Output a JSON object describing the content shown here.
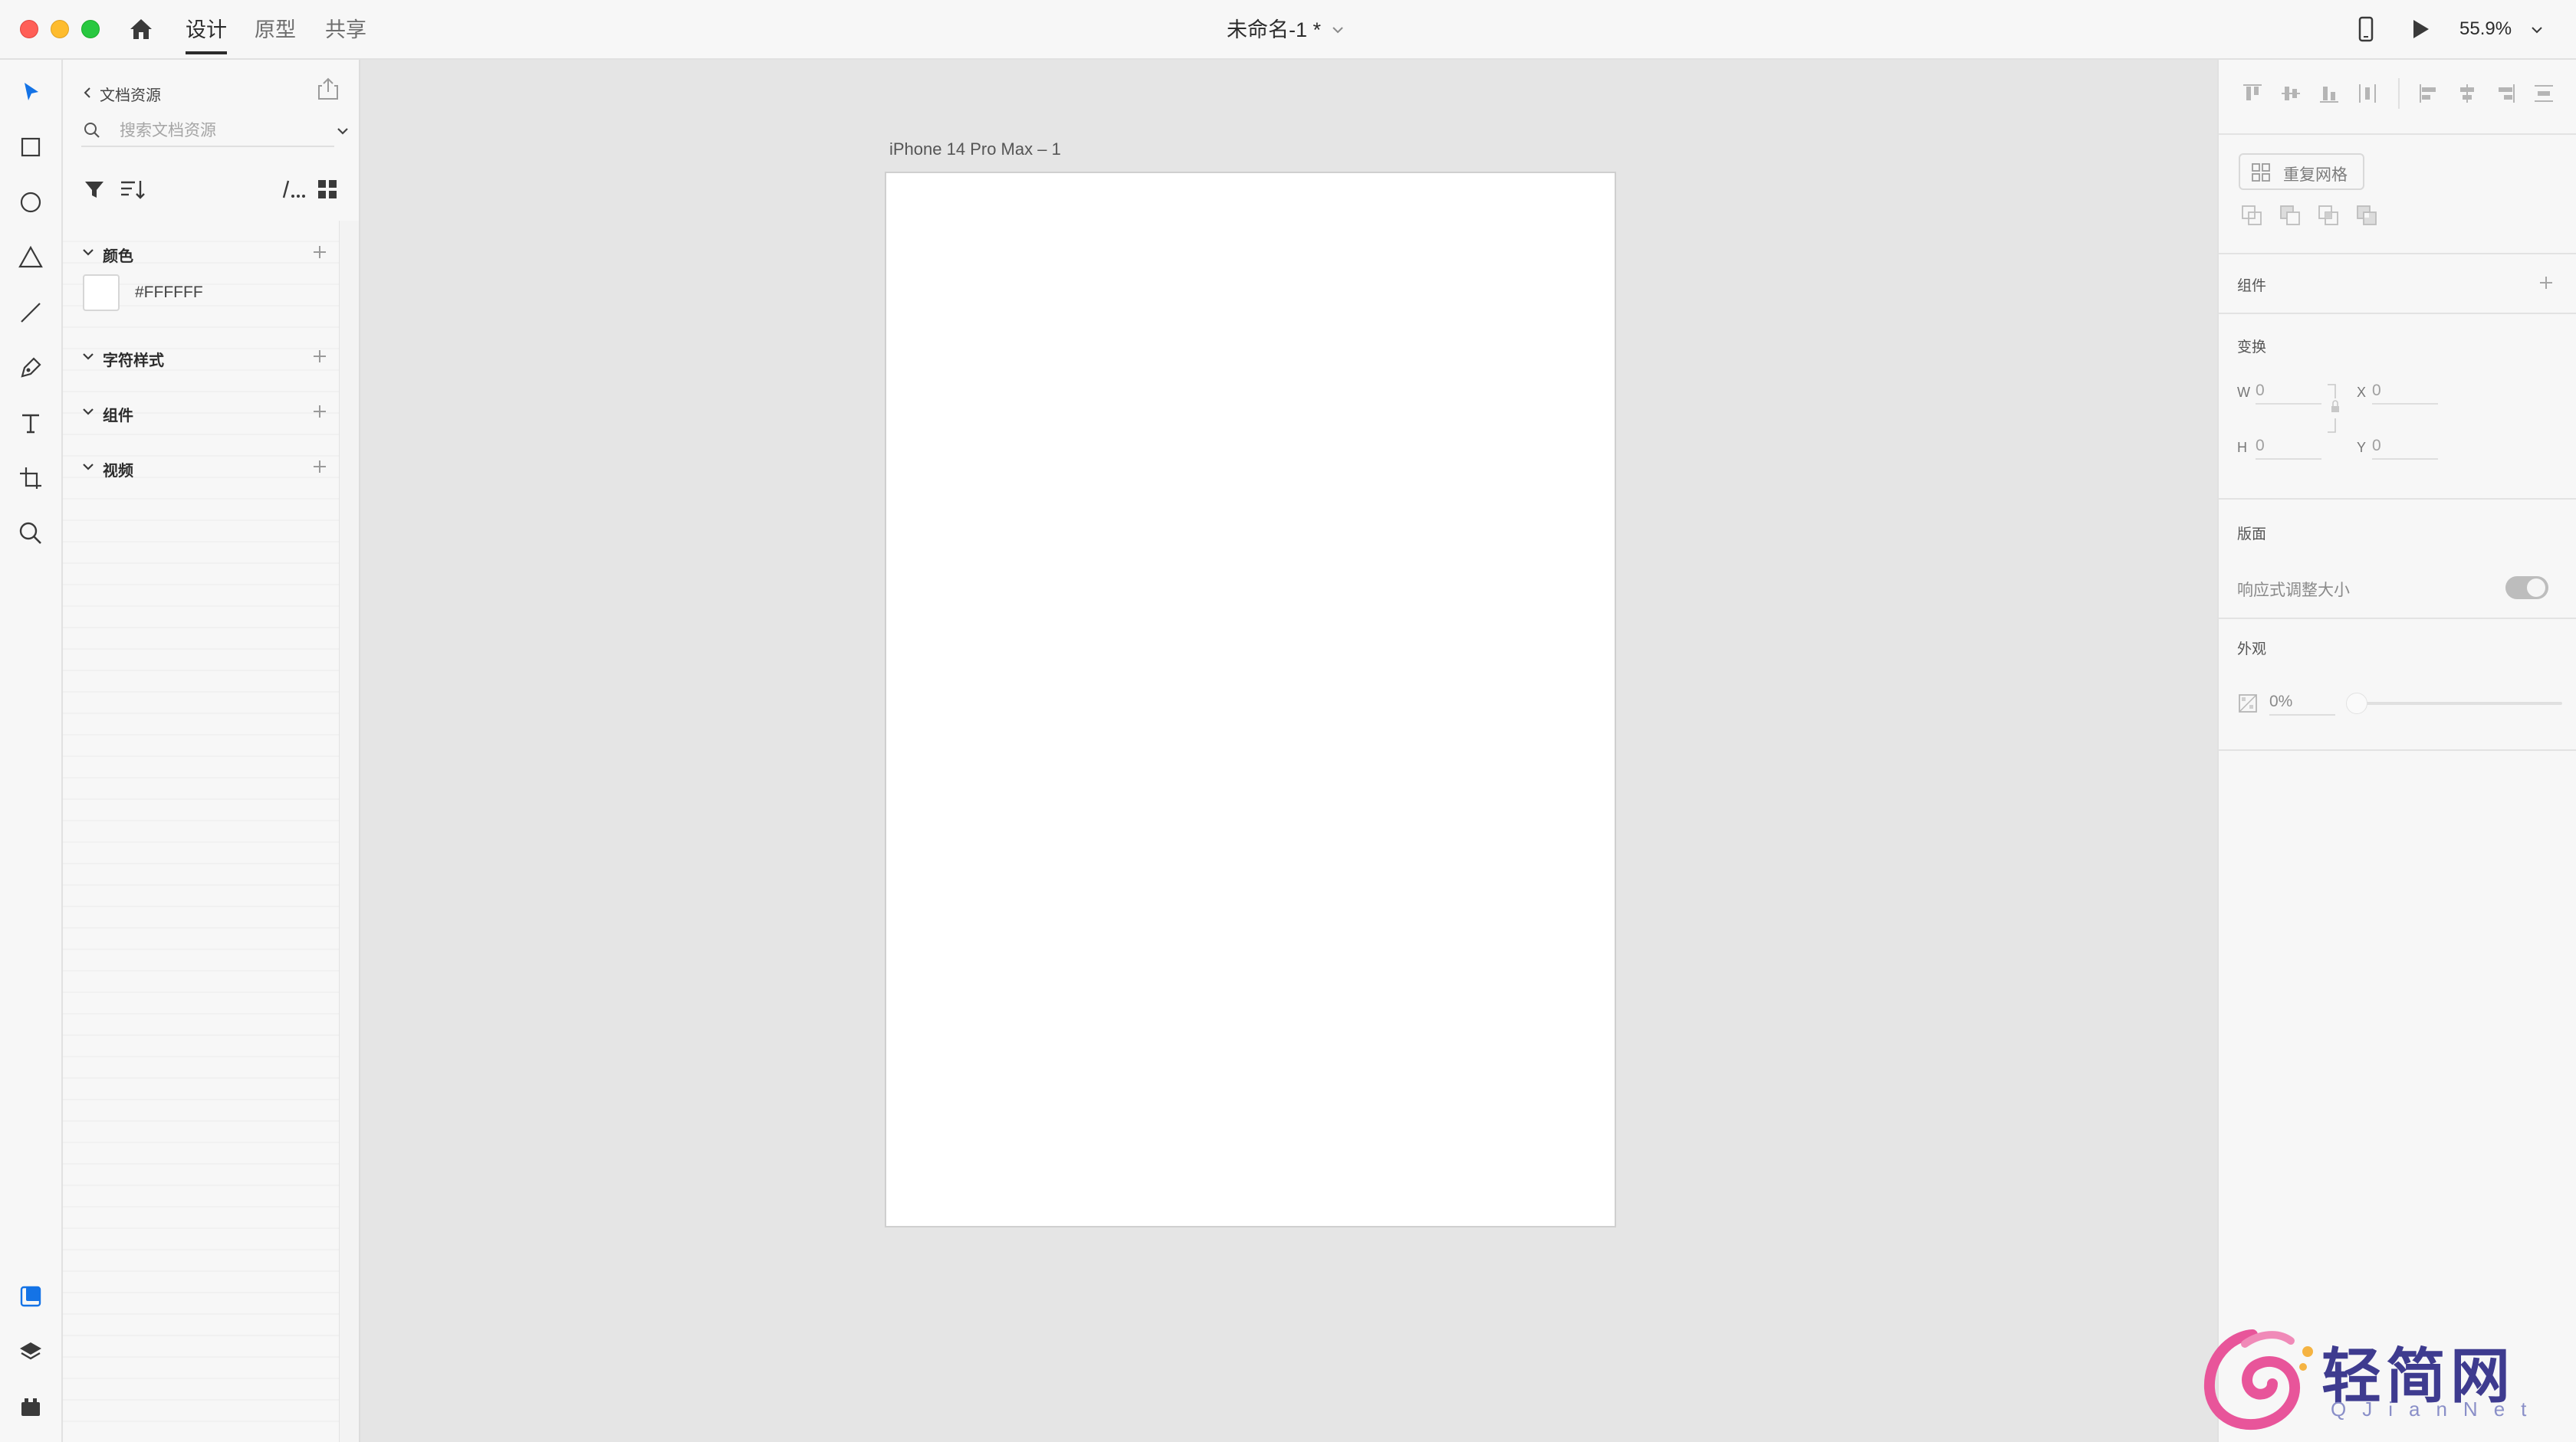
{
  "titlebar": {
    "tabs": [
      {
        "label": "设计",
        "active": true
      },
      {
        "label": "原型",
        "active": false
      },
      {
        "label": "共享",
        "active": false
      }
    ],
    "document_title": "未命名-1 *",
    "zoom": "55.9%"
  },
  "assets_panel": {
    "back_label": "文档资源",
    "search_placeholder": "搜索文档资源",
    "sections": {
      "colors": {
        "label": "颜色",
        "items": [
          {
            "hex": "#FFFFFF"
          }
        ]
      },
      "char_styles": {
        "label": "字符样式"
      },
      "components": {
        "label": "组件"
      },
      "videos": {
        "label": "视频"
      }
    }
  },
  "canvas": {
    "artboard_name": "iPhone 14 Pro Max – 1",
    "artboard_color": "#FFFFFF"
  },
  "inspector": {
    "repeat_grid_label": "重复网格",
    "components_label": "组件",
    "transform": {
      "label": "变换",
      "w_label": "W",
      "w_value": "0",
      "x_label": "X",
      "x_value": "0",
      "h_label": "H",
      "h_value": "0",
      "y_label": "Y",
      "y_value": "0"
    },
    "layout": {
      "label": "版面",
      "responsive_label": "响应式调整大小",
      "responsive_on": true
    },
    "appearance": {
      "label": "外观",
      "opacity": "0%"
    }
  },
  "watermark": {
    "title": "轻简网",
    "subtitle": "QJianNet"
  },
  "colors": {
    "traffic_close": "#FF5F57",
    "traffic_min": "#FEBC2E",
    "traffic_max": "#28C840",
    "accent_blue": "#1473E6",
    "canvas_bg": "#E5E5E5"
  }
}
